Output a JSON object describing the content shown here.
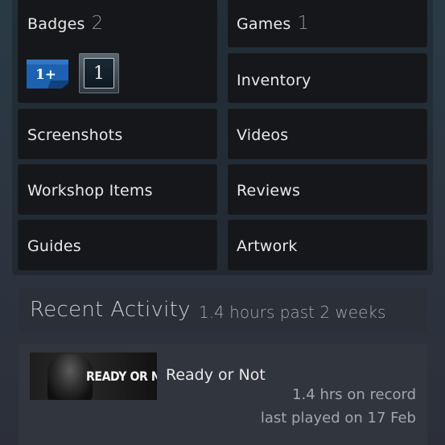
{
  "profile_links": {
    "badges": {
      "label": "Badges",
      "count": "2"
    },
    "games": {
      "label": "Games",
      "count": "1"
    },
    "inventory": {
      "label": "Inventory"
    },
    "screenshots": {
      "label": "Screenshots"
    },
    "videos": {
      "label": "Videos"
    },
    "workshop": {
      "label": "Workshop Items"
    },
    "reviews": {
      "label": "Reviews"
    },
    "guides": {
      "label": "Guides"
    },
    "artwork": {
      "label": "Artwork"
    }
  },
  "badge_icons": [
    {
      "name": "years-of-service-badge",
      "text": "1+",
      "color": "#1c62b0"
    },
    {
      "name": "level-badge",
      "text": "1"
    }
  ],
  "recent_activity": {
    "title": "Recent Activity",
    "summary": "1.4 hours past 2 weeks",
    "games": [
      {
        "capsule_text": "READY OR NOT",
        "name": "Ready or Not",
        "hours": "1.4 hrs on record",
        "last_played": "last played on 17 Feb"
      }
    ]
  },
  "colors": {
    "tile_bg": "#16171b",
    "panel_bg": "#2b2f38",
    "card_bg": "#31353e",
    "muted_text": "#a2a6ac"
  }
}
